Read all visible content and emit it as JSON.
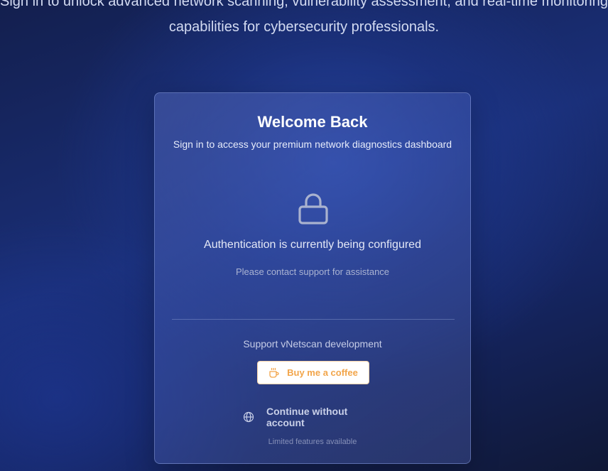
{
  "hero": {
    "text": "Sign in to unlock advanced network scanning, vulnerability assessment, and real-time monitoring capabilities for cybersecurity professionals."
  },
  "card": {
    "title": "Welcome Back",
    "subtitle": "Sign in to access your premium network diagnostics dashboard",
    "lock_icon": "lock-icon",
    "auth_status": "Authentication is currently being configured",
    "auth_help": "Please contact support for assistance",
    "support_text": "Support vNetscan development",
    "coffee_button": {
      "icon": "coffee-cup-icon",
      "label": "Buy me a coffee"
    },
    "continue_link": {
      "icon": "globe-icon",
      "label": "Continue without account"
    },
    "limited_text": "Limited features available"
  },
  "colors": {
    "background": "#1a2f78",
    "accent_orange": "#f2a54a",
    "card_border": "#96aae6"
  }
}
